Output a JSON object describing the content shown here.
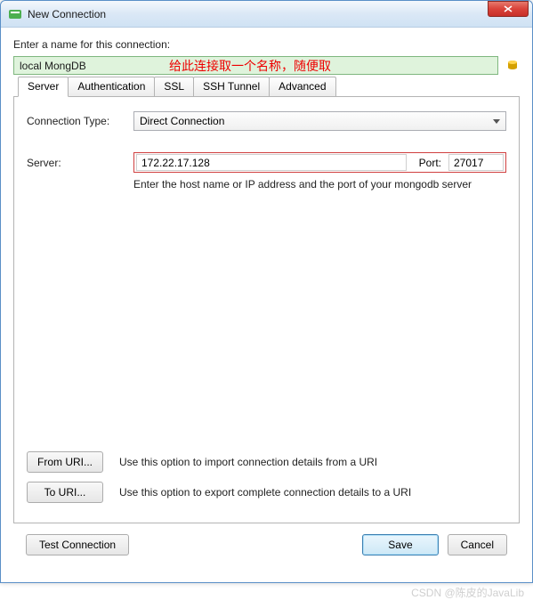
{
  "window": {
    "title": "New Connection"
  },
  "name": {
    "label": "Enter a name for this connection:",
    "value": "local MongDB",
    "annotation": "给此连接取一个名称，随便取"
  },
  "tabs": {
    "server": "Server",
    "authentication": "Authentication",
    "ssl": "SSL",
    "ssh_tunnel": "SSH Tunnel",
    "advanced": "Advanced"
  },
  "form": {
    "conn_type_label": "Connection Type:",
    "conn_type_value": "Direct Connection",
    "server_label": "Server:",
    "server_value": "172.22.17.128",
    "port_label": "Port:",
    "port_value": "27017",
    "hint": "Enter the host name or IP address and the port of your mongodb server"
  },
  "uri": {
    "from_label": "From URI...",
    "from_hint": "Use this option to import connection details from a URI",
    "to_label": "To URI...",
    "to_hint": "Use this option to export complete connection details to a URI"
  },
  "footer": {
    "test": "Test Connection",
    "save": "Save",
    "cancel": "Cancel"
  },
  "watermark": "CSDN @陈皮的JavaLib"
}
